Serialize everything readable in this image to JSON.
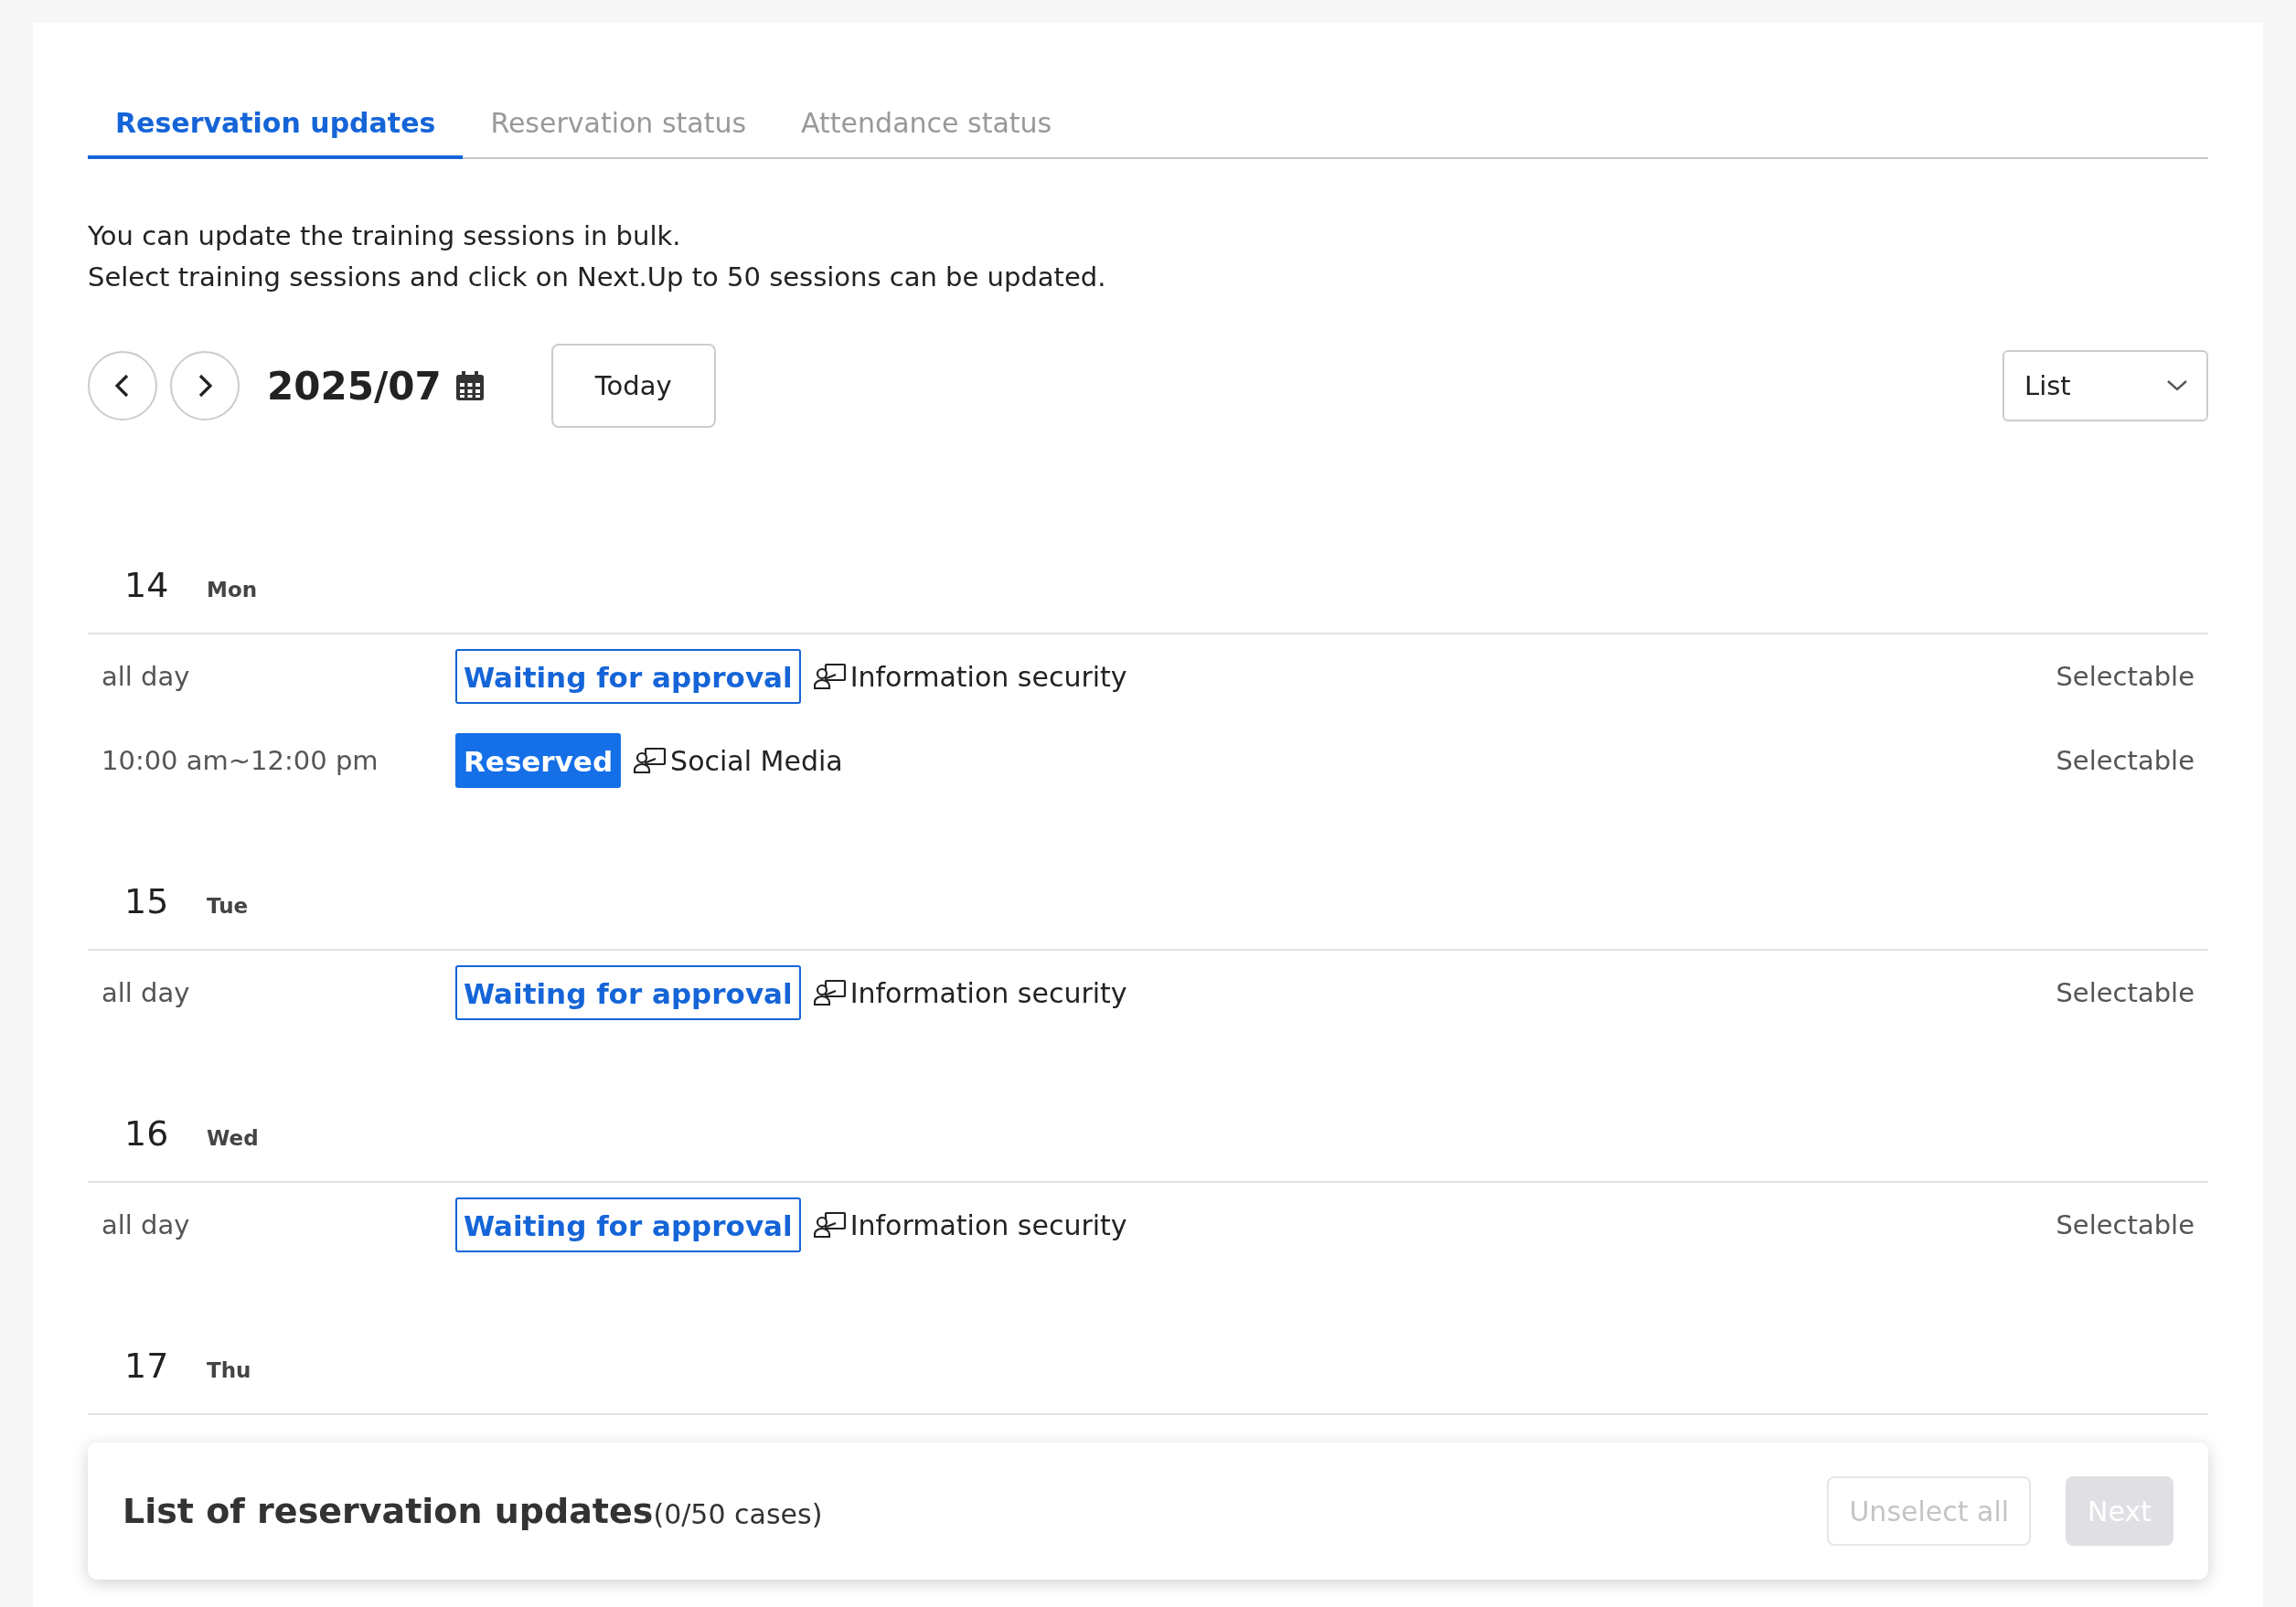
{
  "tabs": [
    {
      "label": "Reservation updates",
      "selected": true
    },
    {
      "label": "Reservation status",
      "selected": false
    },
    {
      "label": "Attendance status",
      "selected": false
    }
  ],
  "intro": [
    "You can update the training sessions in bulk.",
    "Select training sessions and click on Next.Up to 50 sessions can be updated."
  ],
  "nav": {
    "month": "2025/07",
    "today_button": "Today",
    "view_select": {
      "value": "List"
    }
  },
  "days": [
    {
      "day": "14",
      "weekday": "Mon",
      "events": [
        {
          "time": "all day",
          "status": {
            "text": "Waiting for approval",
            "kind": "waiting"
          },
          "title": "Information security",
          "availability": "Selectable"
        },
        {
          "time": "10:00 am~12:00 pm",
          "status": {
            "text": "Reserved",
            "kind": "reserved"
          },
          "title": "Social Media",
          "availability": "Selectable"
        }
      ]
    },
    {
      "day": "15",
      "weekday": "Tue",
      "events": [
        {
          "time": "all day",
          "status": {
            "text": "Waiting for approval",
            "kind": "waiting"
          },
          "title": "Information security",
          "availability": "Selectable"
        }
      ]
    },
    {
      "day": "16",
      "weekday": "Wed",
      "events": [
        {
          "time": "all day",
          "status": {
            "text": "Waiting for approval",
            "kind": "waiting"
          },
          "title": "Information security",
          "availability": "Selectable"
        }
      ]
    },
    {
      "day": "17",
      "weekday": "Thu"
    }
  ],
  "footer": {
    "title": "List of reservation updates",
    "count": "(0/50 cases)",
    "buttons": [
      {
        "label": "Unselect all",
        "kind": "secondary",
        "disabled": true
      },
      {
        "label": "Next",
        "kind": "primary",
        "disabled": true
      }
    ]
  }
}
